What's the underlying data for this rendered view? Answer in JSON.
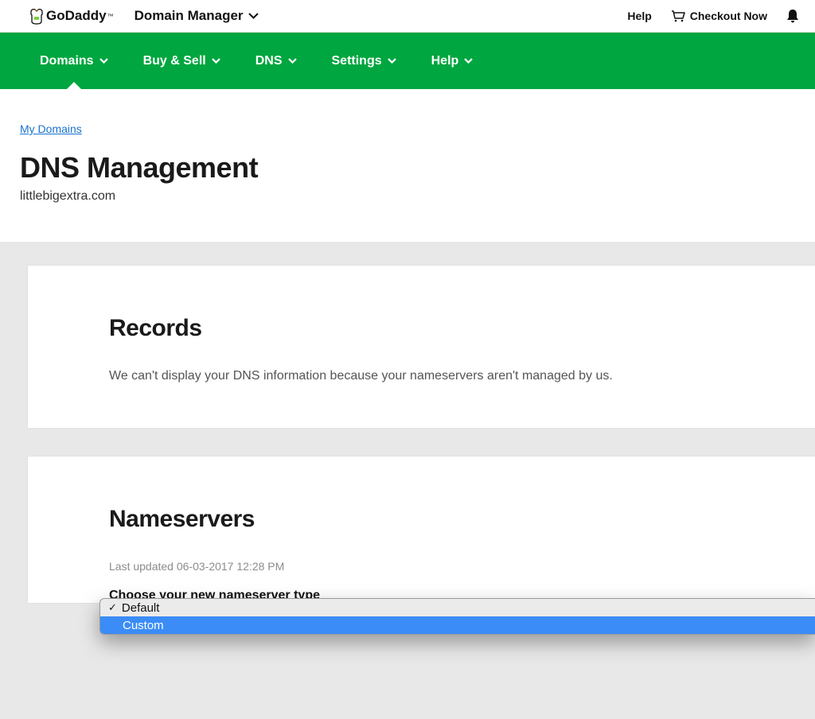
{
  "header": {
    "brand": "GoDaddy",
    "tm": "™",
    "manager_label": "Domain Manager",
    "help_label": "Help",
    "checkout_label": "Checkout Now"
  },
  "nav": {
    "items": [
      {
        "label": "Domains"
      },
      {
        "label": "Buy & Sell"
      },
      {
        "label": "DNS"
      },
      {
        "label": "Settings"
      },
      {
        "label": "Help"
      }
    ]
  },
  "page": {
    "breadcrumb": "My Domains",
    "title": "DNS Management",
    "domain": "littlebigextra.com"
  },
  "records": {
    "title": "Records",
    "message": "We can't display your DNS information because your nameservers aren't managed by us."
  },
  "nameservers": {
    "title": "Nameservers",
    "last_updated": "Last updated 06-03-2017 12:28 PM",
    "choose_label": "Choose your new nameserver type",
    "options": [
      {
        "label": "Default"
      },
      {
        "label": "Custom"
      }
    ]
  }
}
